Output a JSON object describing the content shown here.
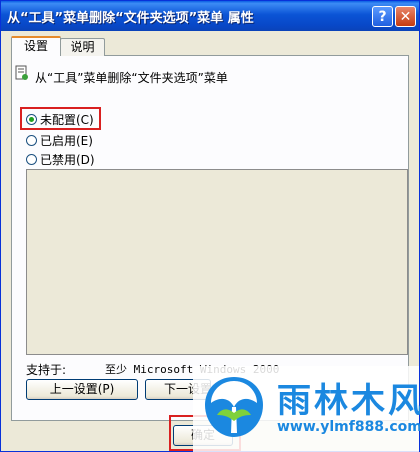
{
  "window": {
    "title": "从“工具”菜单删除“文件夹选项”菜单 属性",
    "help_label": "?",
    "close_label": "✕"
  },
  "tabs": [
    {
      "label": "设置",
      "active": true
    },
    {
      "label": "说明",
      "active": false
    }
  ],
  "policy": {
    "icon": "policy-setting-icon",
    "title": "从“工具”菜单删除“文件夹选项”菜单"
  },
  "options": [
    {
      "label": "未配置(C)",
      "selected": true
    },
    {
      "label": "已启用(E)",
      "selected": false
    },
    {
      "label": "已禁用(D)",
      "selected": false
    }
  ],
  "supported": {
    "label": "支持于:",
    "value": "至少 Microsoft Windows 2000"
  },
  "buttons": {
    "prev": "上一设置(P)",
    "next": "下一设置(N)",
    "ok": "确定"
  },
  "watermark": {
    "name": "雨林木风",
    "url": "www.ylmf888.com"
  },
  "colors": {
    "titlebar": "#0b54d6",
    "highlight": "#d92020",
    "watermark": "#1b88e0",
    "selected_radio": "#21a121"
  }
}
